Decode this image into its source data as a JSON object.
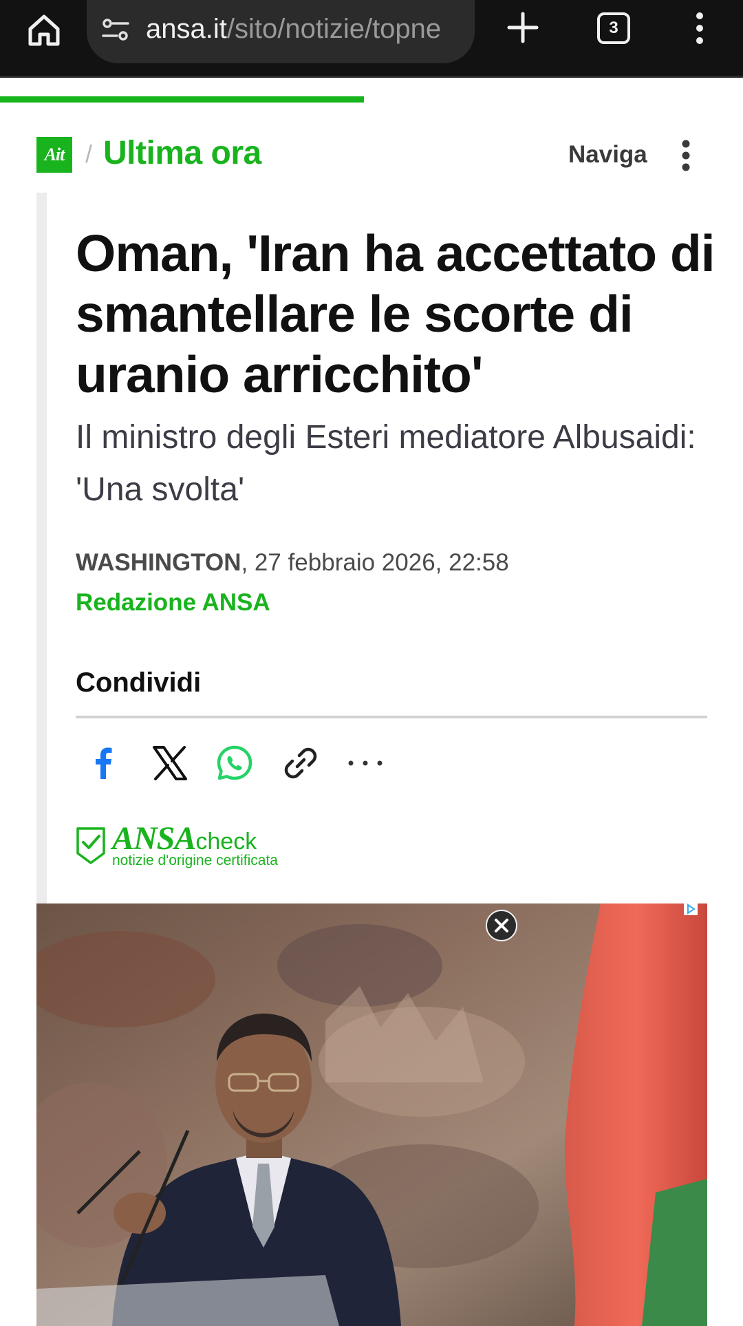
{
  "browser": {
    "url_domain": "ansa.it",
    "url_path": "/sito/notizie/topne",
    "tab_count": "3"
  },
  "page": {
    "progress_percent": 49
  },
  "site": {
    "logo_text": "Ait",
    "breadcrumb_separator": "/",
    "section": "Ultima ora",
    "nav_label": "Naviga"
  },
  "article": {
    "headline": "Oman, 'Iran ha accettato di smantellare le scorte di uranio arricchito'",
    "subtitle": "Il ministro degli Esteri mediatore Albusaidi: 'Una svolta'",
    "city": "WASHINGTON",
    "date": ", 27 febbraio 2026, 22:58",
    "author": "Redazione ANSA"
  },
  "share": {
    "title": "Condividi",
    "icons": [
      "facebook-icon",
      "x-icon",
      "whatsapp-icon",
      "link-icon",
      "more-icon"
    ]
  },
  "ansa_check": {
    "brand": "ANSA",
    "suffix": "check",
    "tagline": "notizie d'origine certificata"
  },
  "colors": {
    "accent": "#19b31e",
    "browser_bar": "#121212",
    "facebook": "#1877f2",
    "whatsapp": "#25d366"
  }
}
